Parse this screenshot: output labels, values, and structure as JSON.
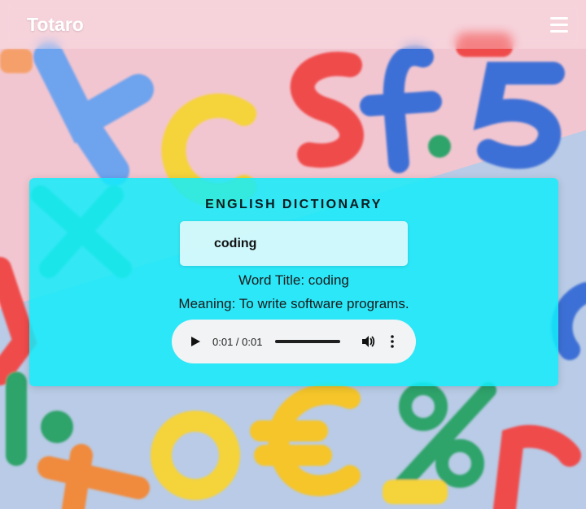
{
  "header": {
    "logo": "Totaro",
    "menu_icon": "hamburger-menu-icon"
  },
  "dictionary": {
    "title": "ENGLISH DICTIONARY",
    "search_value": "coding",
    "word_title": "Word Title: coding",
    "meaning": "Meaning: To write software programs.",
    "audio": {
      "time": "0:01 / 0:01",
      "progress_fraction": 1.0
    }
  },
  "colors": {
    "card": "#12ecfa",
    "header_text": "#ffffff",
    "audio_bg": "#f1f3f4"
  }
}
